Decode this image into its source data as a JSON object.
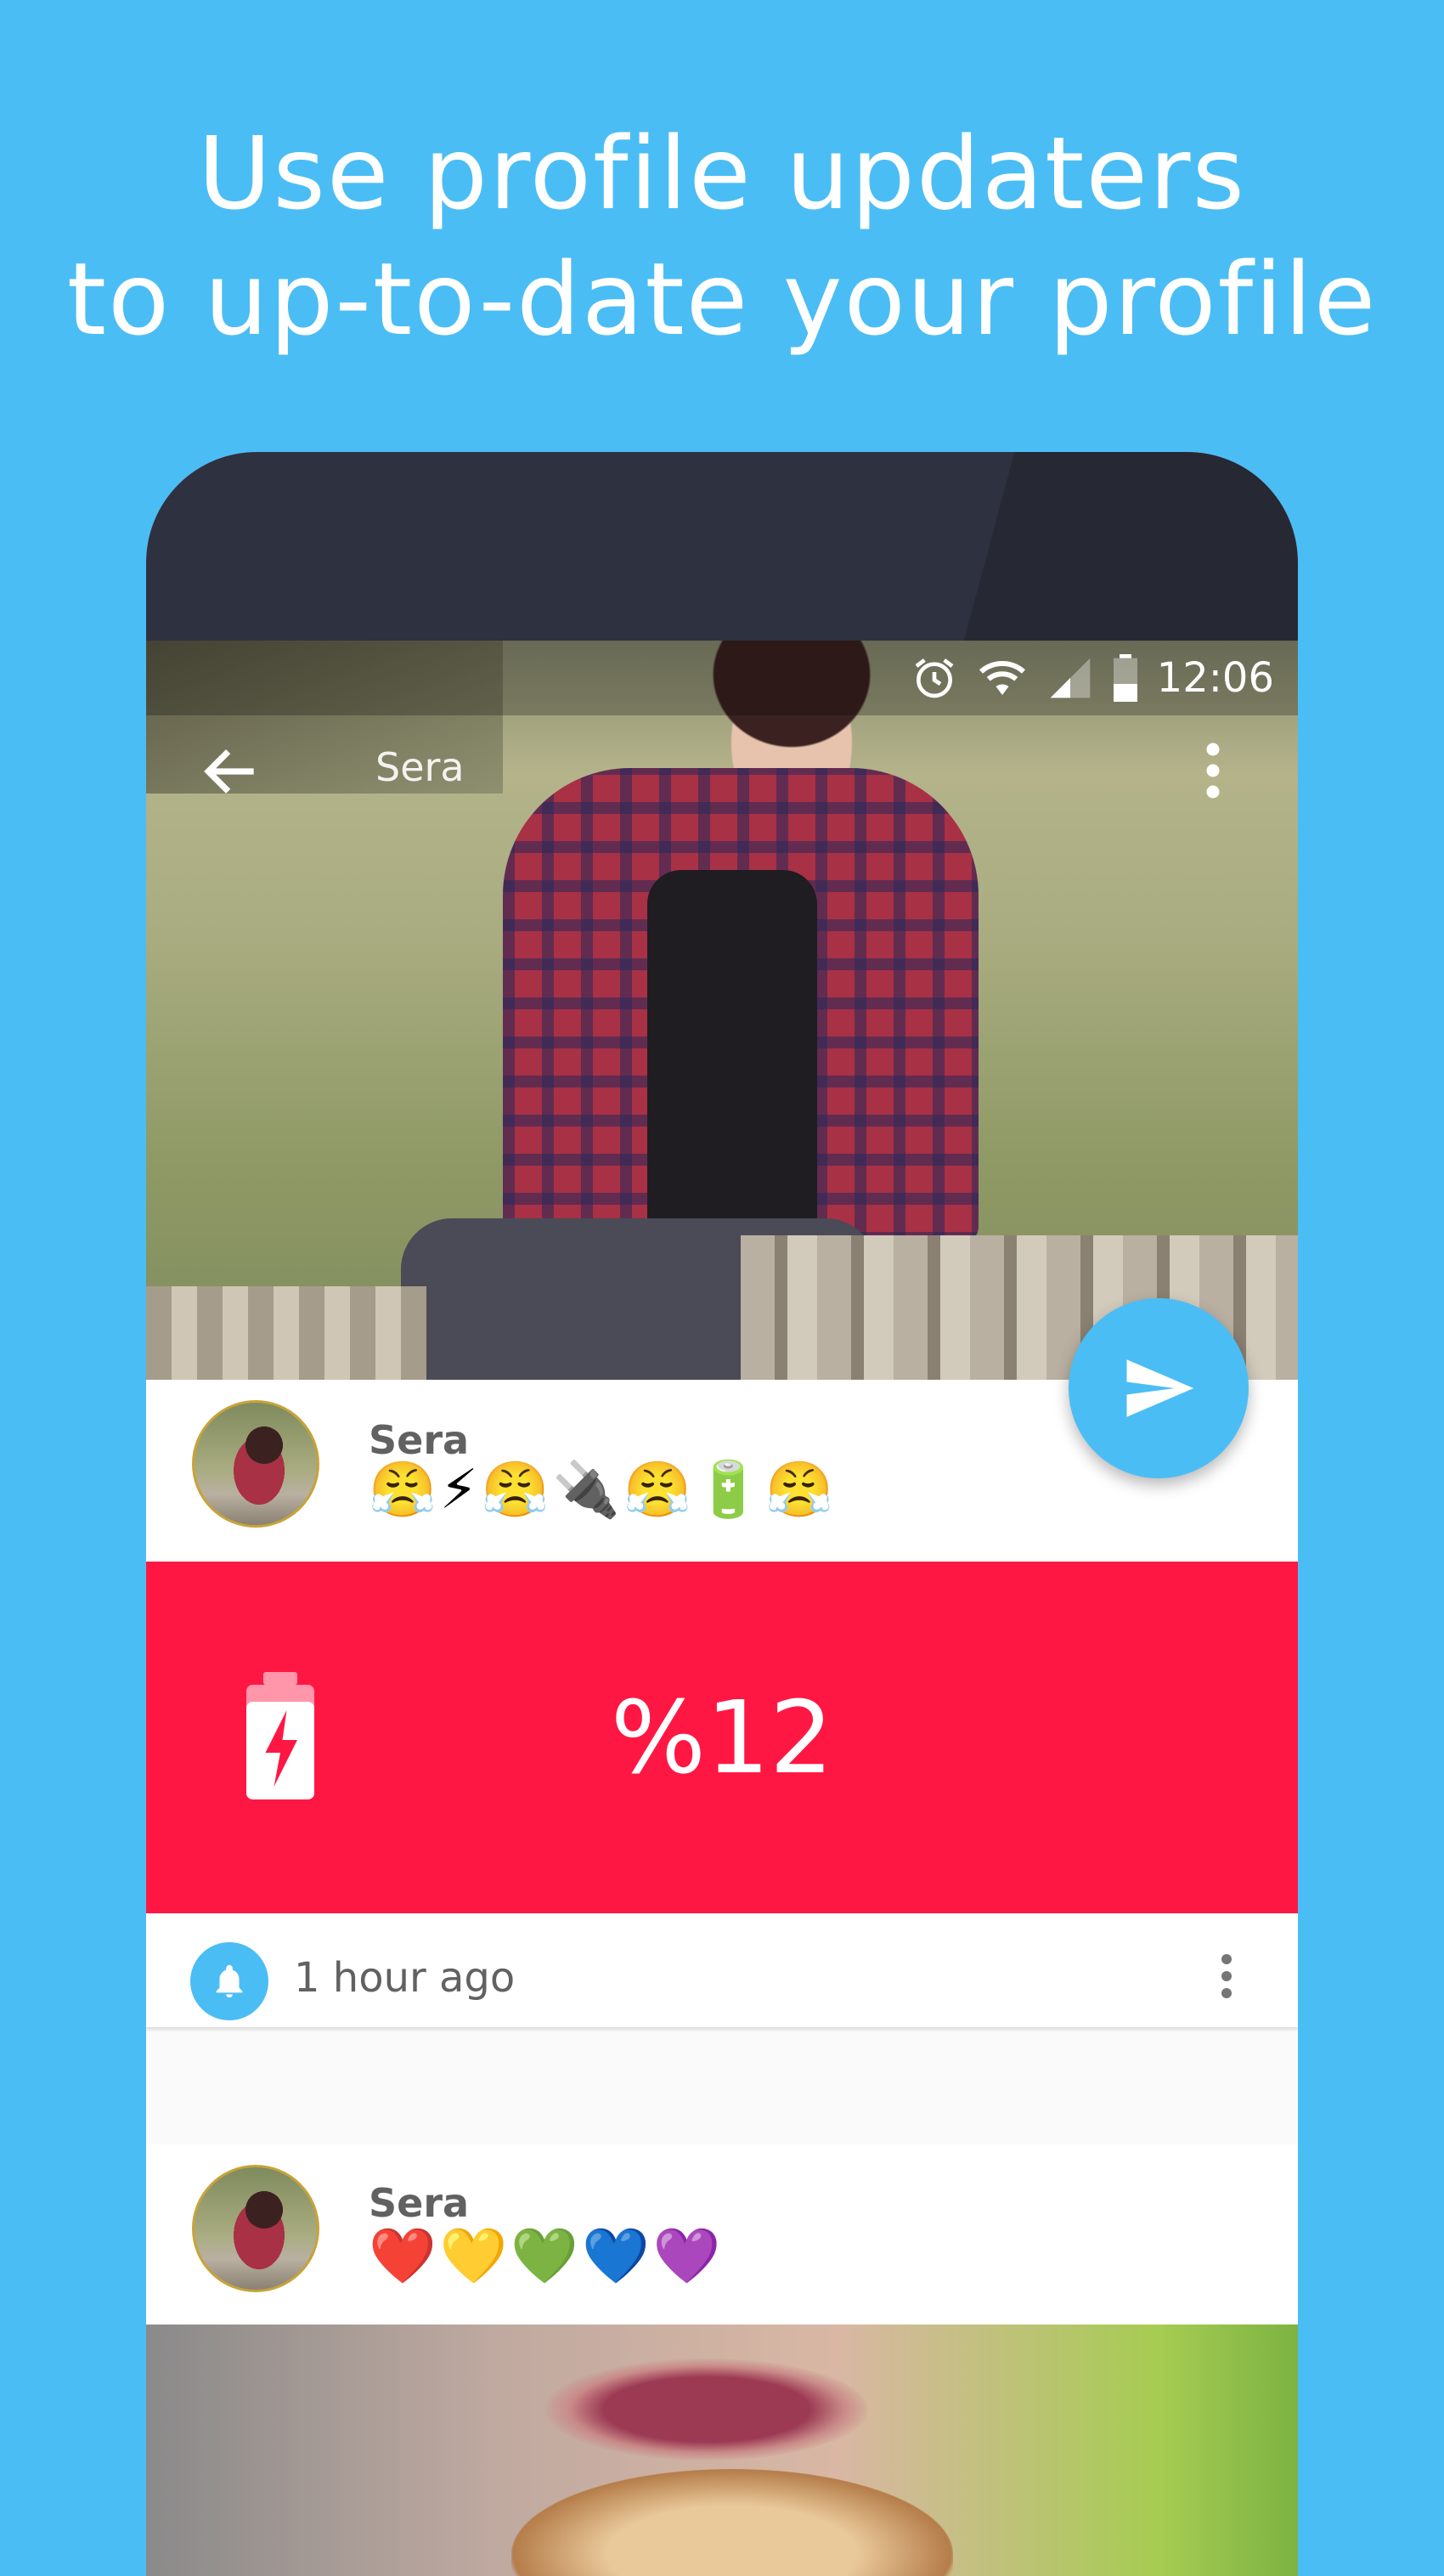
{
  "headline": {
    "line1": "Use profile updaters",
    "line2": "to up-to-date your profile"
  },
  "statusbar": {
    "time": "12:06",
    "icons": [
      "alarm-icon",
      "wifi-icon",
      "signal-icon",
      "battery-icon"
    ]
  },
  "appbar": {
    "title": "Sera",
    "back_icon": "arrow-left-icon",
    "more_icon": "more-vert-icon"
  },
  "fab": {
    "icon": "send-icon",
    "color": "#4bbdf5"
  },
  "post1": {
    "username": "Sera",
    "status_emoji": "😤⚡😤🔌😤🔋😤",
    "battery_level": "%12",
    "banner_color": "#ff1744",
    "footer_icon": "bell-icon",
    "timestamp": "1 hour ago",
    "more_icon": "more-vert-icon"
  },
  "post2": {
    "username": "Sera",
    "status_emoji": "❤️💛💚💙💜"
  },
  "colors": {
    "background": "#4bbdf5",
    "accent": "#4bbdf5",
    "battery_banner": "#ff1744",
    "bezel": "#2e3140"
  }
}
